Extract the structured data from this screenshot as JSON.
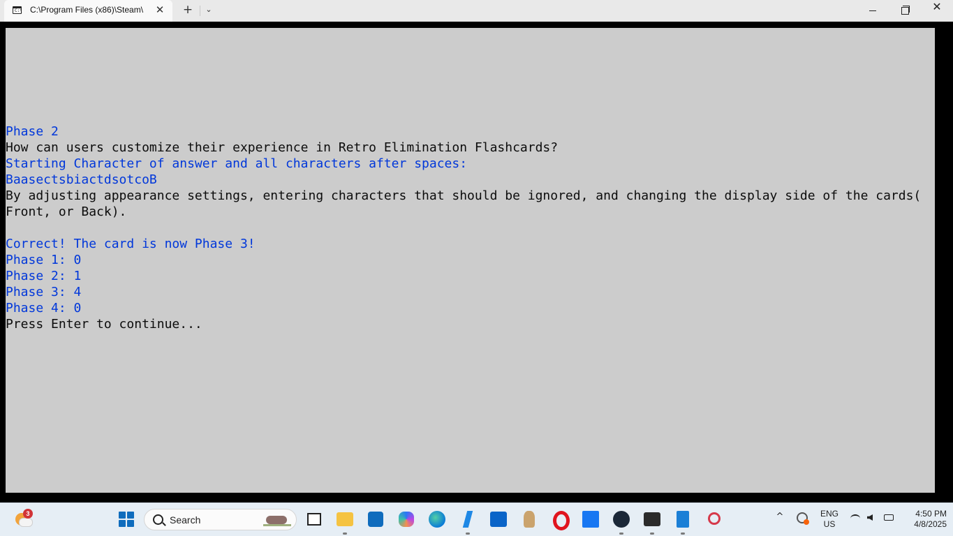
{
  "window": {
    "tab_title": "C:\\Program Files (x86)\\Steam\\",
    "tab_close": "✕",
    "new_tab": "+",
    "tab_dropdown": "⌄",
    "close_glyph": "✕"
  },
  "console": {
    "lines": [
      {
        "text": "Phase 2",
        "color": "blue"
      },
      {
        "text": "How can users customize their experience in Retro Elimination Flashcards?",
        "color": "black"
      },
      {
        "text": "Starting Character of answer and all characters after spaces:",
        "color": "blue"
      },
      {
        "text": "BaasectsbiactdsotcoB",
        "color": "blue"
      },
      {
        "text": "By adjusting appearance settings, entering characters that should be ignored, and changing the display side of the cards(",
        "color": "black"
      },
      {
        "text": "Front, or Back).",
        "color": "black"
      },
      {
        "text": "",
        "color": "black"
      },
      {
        "text": "Correct! The card is now Phase 3!",
        "color": "blue"
      },
      {
        "text": "Phase 1: 0",
        "color": "blue"
      },
      {
        "text": "Phase 2: 1",
        "color": "blue"
      },
      {
        "text": "Phase 3: 4",
        "color": "blue"
      },
      {
        "text": "Phase 4: 0",
        "color": "blue"
      },
      {
        "text": "Press Enter to continue...",
        "color": "black"
      }
    ]
  },
  "colors": {
    "console_bg": "#cccccc",
    "console_blue": "#0037da",
    "console_black": "#0c0c0c",
    "taskbar_bg": "#e6eef5"
  },
  "taskbar": {
    "weather_badge": "3",
    "search_label": "Search",
    "tray_chevron": "^",
    "lang_line1": "ENG",
    "lang_line2": "US",
    "time": "4:50 PM",
    "date": "4/8/2025",
    "apps": [
      {
        "name": "task-view-icon"
      },
      {
        "name": "file-explorer-icon"
      },
      {
        "name": "microsoft-store-icon"
      },
      {
        "name": "copilot-icon"
      },
      {
        "name": "edge-icon"
      },
      {
        "name": "visual-studio-icon"
      },
      {
        "name": "outlook-new-icon"
      },
      {
        "name": "game-character-icon"
      },
      {
        "name": "opera-icon"
      },
      {
        "name": "facebook-icon"
      },
      {
        "name": "steam-icon"
      },
      {
        "name": "terminal-icon"
      },
      {
        "name": "notepad-icon"
      },
      {
        "name": "snipping-tool-icon"
      }
    ]
  }
}
